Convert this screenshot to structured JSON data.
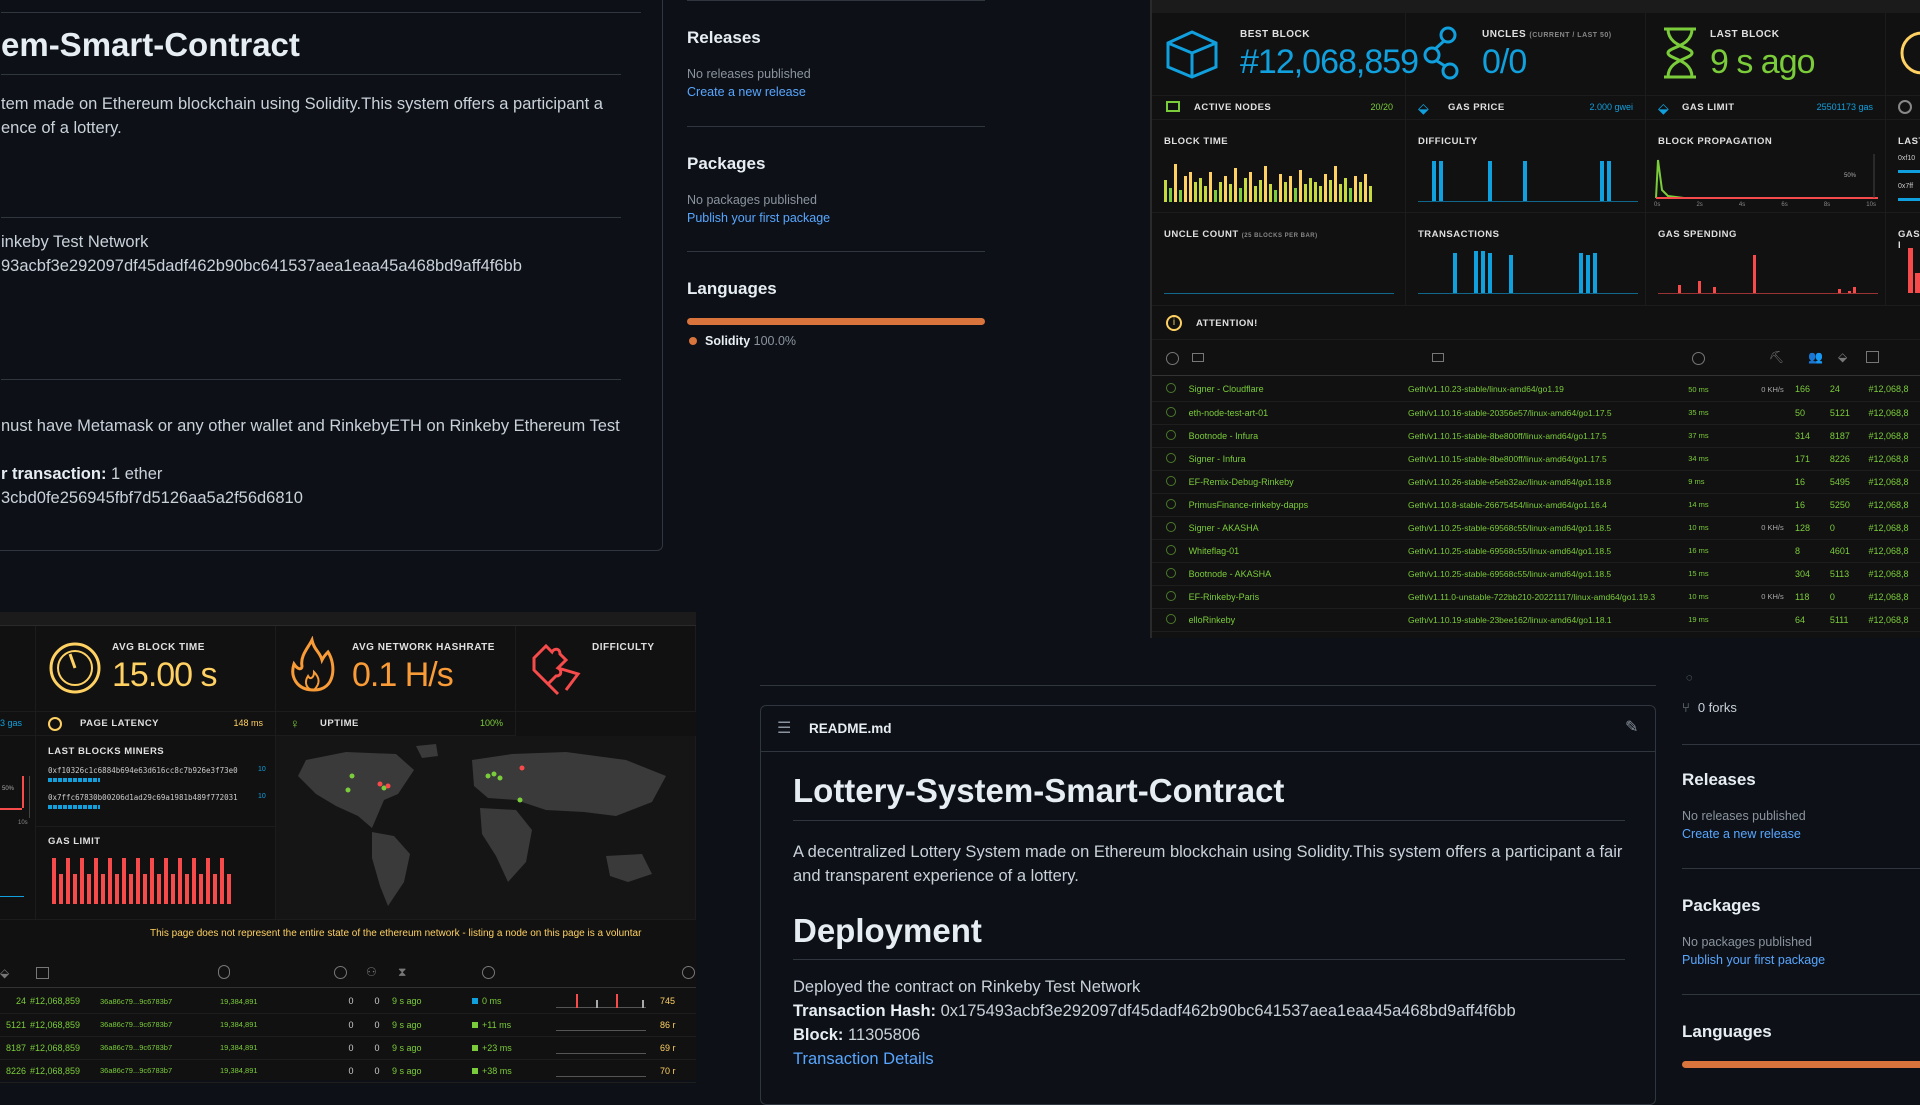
{
  "left_repo": {
    "title": "em-Smart-Contract",
    "desc_line1": "tem made on Ethereum blockchain using Solidity.This system offers a participant a",
    "desc_line2": "ence of a lottery.",
    "network_line": "inkeby Test Network",
    "hash_line": "93acbf3e292097df45dadf462b90bc641537aea1eaa45a468bd9aff4f6bb",
    "metamask_line": "nust have Metamask or any other wallet and RinkebyETH on Rinkeby Ethereum Test",
    "tx_label": "r transaction:",
    "tx_value": " 1 ether",
    "addr_line": "3cbd0fe256945fbf7d5126aa5a2f56d6810",
    "side": {
      "releases_title": "Releases",
      "releases_text": "No releases published",
      "releases_link": "Create a new release",
      "packages_title": "Packages",
      "packages_text": "No packages published",
      "packages_link": "Publish your first package",
      "languages_title": "Languages",
      "lang_name": "Solidity",
      "lang_pct": "100.0%"
    }
  },
  "top_stats": {
    "best_block_label": "BEST BLOCK",
    "best_block_value": "#12,068,859",
    "uncles_label": "UNCLES",
    "uncles_sub": "(CURRENT / LAST 50)",
    "uncles_value": "0/0",
    "last_block_label": "LAST BLOCK",
    "last_block_value": "9 s ago",
    "active_nodes_label": "ACTIVE NODES",
    "active_nodes_value": "20/20",
    "gas_price_label": "GAS PRICE",
    "gas_price_value": "2.000 gwei",
    "gas_limit_label": "GAS LIMIT",
    "gas_limit_value": "25501173 gas",
    "last_cut": "LAST",
    "block_time_label": "BLOCK TIME",
    "difficulty_label": "DIFFICULTY",
    "block_prop_label": "BLOCK PROPAGATION",
    "uncle_count_label": "UNCLE COUNT",
    "uncle_count_sub": "(25 BLOCKS PER BAR)",
    "transactions_label": "TRANSACTIONS",
    "gas_spending_label": "GAS SPENDING",
    "gas_cut": "GAS I",
    "attention_label": "ATTENTION!",
    "prop_pct": "50%",
    "prop_ticks": [
      "0s",
      "2s",
      "4s",
      "6s",
      "8s",
      "10s"
    ],
    "addr_cut1": "0xf10",
    "addr_cut2": "0x7ff"
  },
  "nodes": [
    {
      "name": "Signer - Cloudflare",
      "ver": "Geth/v1.10.23-stable/linux-amd64/go1.19",
      "lat": "50 ms",
      "hr": "0 KH/s",
      "peers": "166",
      "pend": "24",
      "block": "#12,068,8"
    },
    {
      "name": "eth-node-test-art-01",
      "ver": "Geth/v1.10.16-stable-20356e57/linux-amd64/go1.17.5",
      "lat": "35 ms",
      "hr": "",
      "peers": "50",
      "pend": "5121",
      "block": "#12,068,8"
    },
    {
      "name": "Bootnode - Infura",
      "ver": "Geth/v1.10.15-stable-8be800ff/linux-amd64/go1.17.5",
      "lat": "37 ms",
      "hr": "",
      "peers": "314",
      "pend": "8187",
      "block": "#12,068,8"
    },
    {
      "name": "Signer - Infura",
      "ver": "Geth/v1.10.15-stable-8be800ff/linux-amd64/go1.17.5",
      "lat": "34 ms",
      "hr": "",
      "peers": "171",
      "pend": "8226",
      "block": "#12,068,8"
    },
    {
      "name": "EF-Remix-Debug-Rinkeby",
      "ver": "Geth/v1.10.26-stable-e5eb32ac/linux-amd64/go1.18.8",
      "lat": "9 ms",
      "hr": "",
      "peers": "16",
      "pend": "5495",
      "block": "#12,068,8"
    },
    {
      "name": "PrimusFinance-rinkeby-dapps",
      "ver": "Geth/v1.10.8-stable-26675454/linux-amd64/go1.16.4",
      "lat": "14 ms",
      "hr": "",
      "peers": "16",
      "pend": "5250",
      "block": "#12,068,8"
    },
    {
      "name": "Signer - AKASHA",
      "ver": "Geth/v1.10.25-stable-69568c55/linux-amd64/go1.18.5",
      "lat": "10 ms",
      "hr": "0 KH/s",
      "peers": "128",
      "pend": "0",
      "block": "#12,068,8"
    },
    {
      "name": "Whiteflag-01",
      "ver": "Geth/v1.10.25-stable-69568c55/linux-amd64/go1.18.5",
      "lat": "16 ms",
      "hr": "",
      "peers": "8",
      "pend": "4601",
      "block": "#12,068,8"
    },
    {
      "name": "Bootnode - AKASHA",
      "ver": "Geth/v1.10.25-stable-69568c55/linux-amd64/go1.18.5",
      "lat": "15 ms",
      "hr": "",
      "peers": "304",
      "pend": "5113",
      "block": "#12,068,8"
    },
    {
      "name": "EF-Rinkeby-Paris",
      "ver": "Geth/v1.11.0-unstable-722bb210-20221117/linux-amd64/go1.19.3",
      "lat": "10 ms",
      "hr": "0 KH/s",
      "peers": "118",
      "pend": "0",
      "block": "#12,068,8"
    },
    {
      "name": "elloRinkeby",
      "ver": "Geth/v1.10.19-stable-23bee162/linux-amd64/go1.18.1",
      "lat": "19 ms",
      "hr": "",
      "peers": "64",
      "pend": "5111",
      "block": "#12,068,8"
    }
  ],
  "bottom_stats": {
    "avg_block_time_label": "AVG BLOCK TIME",
    "avg_block_time_value": "15.00 s",
    "avg_hashrate_label": "AVG NETWORK HASHRATE",
    "avg_hashrate_value": "0.1 H/s",
    "difficulty_label": "DIFFICULTY",
    "gas_cut": "3 gas",
    "page_latency_label": "PAGE LATENCY",
    "page_latency_value": "148 ms",
    "uptime_label": "UPTIME",
    "uptime_value": "100%",
    "miners_label": "LAST BLOCKS MINERS",
    "miner1": "0xf10326c1c6884b694e63d616cc8c7b926e3f73e0",
    "miner1_count": "10",
    "miner2": "0x7ffc67830b00206d1ad29c69a1981b489f772031",
    "miner2_count": "10",
    "gas_limit_label": "GAS LIMIT",
    "prop_pct": "50%",
    "prop_tick": "10s",
    "notice": "This page does not represent the entire state of the ethereum network - listing a node on this page is a voluntar"
  },
  "bottom_rows": [
    {
      "pend": "24",
      "block": "#12,068,859",
      "hash": "36a86c79...9c6783b7",
      "diff": "19,384,891",
      "u": "0",
      "t": "0",
      "ago": "9 s ago",
      "prop": "0 ms",
      "last": "745"
    },
    {
      "pend": "5121",
      "block": "#12,068,859",
      "hash": "36a86c79...9c6783b7",
      "diff": "19,384,891",
      "u": "0",
      "t": "0",
      "ago": "9 s ago",
      "prop": "+11 ms",
      "last": "86 r"
    },
    {
      "pend": "8187",
      "block": "#12,068,859",
      "hash": "36a86c79...9c6783b7",
      "diff": "19,384,891",
      "u": "0",
      "t": "0",
      "ago": "9 s ago",
      "prop": "+23 ms",
      "last": "69 r"
    },
    {
      "pend": "8226",
      "block": "#12,068,859",
      "hash": "36a86c79...9c6783b7",
      "diff": "19,384,891",
      "u": "0",
      "t": "0",
      "ago": "9 s ago",
      "prop": "+38 ms",
      "last": "70 r"
    }
  ],
  "readme": {
    "file": "README.md",
    "title": "Lottery-System-Smart-Contract",
    "p1": "A decentralized Lottery System made on Ethereum blockchain using Solidity.This system offers a participant a fair and transparent experience of a lottery.",
    "h2": "Deployment",
    "deployed": "Deployed the contract on Rinkeby Test Network",
    "tx_hash_label": "Transaction Hash:",
    "tx_hash_value": " 0x175493acbf3e292097df45dadf462b90bc641537aea1eaa45a468bd9aff4f6bb",
    "block_label": "Block:",
    "block_value": " 11305806",
    "tx_details_link": "Transaction Details"
  },
  "right_side": {
    "forks": "0 forks",
    "releases_title": "Releases",
    "releases_text": "No releases published",
    "releases_link": "Create a new release",
    "packages_title": "Packages",
    "packages_text": "No packages published",
    "packages_link": "Publish your first package",
    "languages_title": "Languages"
  },
  "colors": {
    "accent_link": "#58a6ff",
    "ethstats_blue": "#10a0de",
    "ethstats_green": "#7bcc3a",
    "ethstats_red": "#f74b4b",
    "ethstats_yellow": "#ffd162",
    "solidity": "#d8743c"
  }
}
